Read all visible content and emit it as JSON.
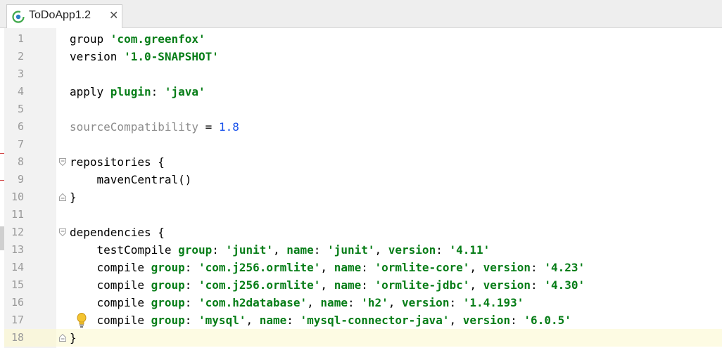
{
  "tab": {
    "label": "ToDoApp1.2",
    "close_glyph": "✕",
    "icon": "gradle-project-icon"
  },
  "editor": {
    "line_numbers": [
      "1",
      "2",
      "3",
      "4",
      "5",
      "6",
      "7",
      "8",
      "9",
      "10",
      "11",
      "12",
      "13",
      "14",
      "15",
      "16",
      "17",
      "18"
    ],
    "current_line": 18,
    "lines": [
      {
        "tokens": [
          {
            "t": "group ",
            "c": "plain"
          },
          {
            "t": "'com.greenfox'",
            "c": "str"
          }
        ]
      },
      {
        "tokens": [
          {
            "t": "version ",
            "c": "plain"
          },
          {
            "t": "'1.0-SNAPSHOT'",
            "c": "str"
          }
        ]
      },
      {
        "tokens": []
      },
      {
        "tokens": [
          {
            "t": "apply ",
            "c": "plain"
          },
          {
            "t": "plugin",
            "c": "kw"
          },
          {
            "t": ": ",
            "c": "plain"
          },
          {
            "t": "'java'",
            "c": "str"
          }
        ]
      },
      {
        "tokens": []
      },
      {
        "tokens": [
          {
            "t": "sourceCompatibility",
            "c": "dim"
          },
          {
            "t": " = ",
            "c": "plain"
          },
          {
            "t": "1.8",
            "c": "num"
          }
        ]
      },
      {
        "tokens": []
      },
      {
        "tokens": [
          {
            "t": "repositories {",
            "c": "plain"
          }
        ]
      },
      {
        "tokens": [
          {
            "t": "    mavenCentral()",
            "c": "plain"
          }
        ]
      },
      {
        "tokens": [
          {
            "t": "}",
            "c": "plain"
          }
        ]
      },
      {
        "tokens": []
      },
      {
        "tokens": [
          {
            "t": "dependencies {",
            "c": "plain"
          }
        ]
      },
      {
        "tokens": [
          {
            "t": "    testCompile ",
            "c": "plain"
          },
          {
            "t": "group",
            "c": "kw"
          },
          {
            "t": ": ",
            "c": "plain"
          },
          {
            "t": "'junit'",
            "c": "str"
          },
          {
            "t": ", ",
            "c": "plain"
          },
          {
            "t": "name",
            "c": "kw"
          },
          {
            "t": ": ",
            "c": "plain"
          },
          {
            "t": "'junit'",
            "c": "str"
          },
          {
            "t": ", ",
            "c": "plain"
          },
          {
            "t": "version",
            "c": "kw"
          },
          {
            "t": ": ",
            "c": "plain"
          },
          {
            "t": "'4.11'",
            "c": "str"
          }
        ]
      },
      {
        "tokens": [
          {
            "t": "    compile ",
            "c": "plain"
          },
          {
            "t": "group",
            "c": "kw"
          },
          {
            "t": ": ",
            "c": "plain"
          },
          {
            "t": "'com.j256.ormlite'",
            "c": "str"
          },
          {
            "t": ", ",
            "c": "plain"
          },
          {
            "t": "name",
            "c": "kw"
          },
          {
            "t": ": ",
            "c": "plain"
          },
          {
            "t": "'ormlite-core'",
            "c": "str"
          },
          {
            "t": ", ",
            "c": "plain"
          },
          {
            "t": "version",
            "c": "kw"
          },
          {
            "t": ": ",
            "c": "plain"
          },
          {
            "t": "'4.23'",
            "c": "str"
          }
        ]
      },
      {
        "tokens": [
          {
            "t": "    compile ",
            "c": "plain"
          },
          {
            "t": "group",
            "c": "kw"
          },
          {
            "t": ": ",
            "c": "plain"
          },
          {
            "t": "'com.j256.ormlite'",
            "c": "str"
          },
          {
            "t": ", ",
            "c": "plain"
          },
          {
            "t": "name",
            "c": "kw"
          },
          {
            "t": ": ",
            "c": "plain"
          },
          {
            "t": "'ormlite-jdbc'",
            "c": "str"
          },
          {
            "t": ", ",
            "c": "plain"
          },
          {
            "t": "version",
            "c": "kw"
          },
          {
            "t": ": ",
            "c": "plain"
          },
          {
            "t": "'4.30'",
            "c": "str"
          }
        ]
      },
      {
        "tokens": [
          {
            "t": "    compile ",
            "c": "plain"
          },
          {
            "t": "group",
            "c": "kw"
          },
          {
            "t": ": ",
            "c": "plain"
          },
          {
            "t": "'com.h2database'",
            "c": "str"
          },
          {
            "t": ", ",
            "c": "plain"
          },
          {
            "t": "name",
            "c": "kw"
          },
          {
            "t": ": ",
            "c": "plain"
          },
          {
            "t": "'h2'",
            "c": "str"
          },
          {
            "t": ", ",
            "c": "plain"
          },
          {
            "t": "version",
            "c": "kw"
          },
          {
            "t": ": ",
            "c": "plain"
          },
          {
            "t": "'1.4.193'",
            "c": "str"
          }
        ]
      },
      {
        "tokens": [
          {
            "t": "    compile ",
            "c": "plain"
          },
          {
            "t": "group",
            "c": "kw"
          },
          {
            "t": ": ",
            "c": "plain"
          },
          {
            "t": "'mysql'",
            "c": "str"
          },
          {
            "t": ", ",
            "c": "plain"
          },
          {
            "t": "name",
            "c": "kw"
          },
          {
            "t": ": ",
            "c": "plain"
          },
          {
            "t": "'mysql-connector-java'",
            "c": "str"
          },
          {
            "t": ", ",
            "c": "plain"
          },
          {
            "t": "version",
            "c": "kw"
          },
          {
            "t": ": ",
            "c": "plain"
          },
          {
            "t": "'6.0.5'",
            "c": "str"
          }
        ]
      },
      {
        "tokens": [
          {
            "t": "}",
            "c": "plain"
          }
        ]
      }
    ],
    "fold_markers": [
      {
        "line": 8,
        "kind": "open"
      },
      {
        "line": 10,
        "kind": "close"
      },
      {
        "line": 12,
        "kind": "open"
      },
      {
        "line": 18,
        "kind": "close"
      }
    ],
    "intention_bulb_line": 17,
    "colors": {
      "string": "#067d17",
      "number": "#1750eb",
      "dimmed": "#8c8c8c",
      "line_number": "#9a9a9a",
      "gutter_bg": "#f2f2f2",
      "current_line_bg": "#fdfbe3"
    }
  }
}
